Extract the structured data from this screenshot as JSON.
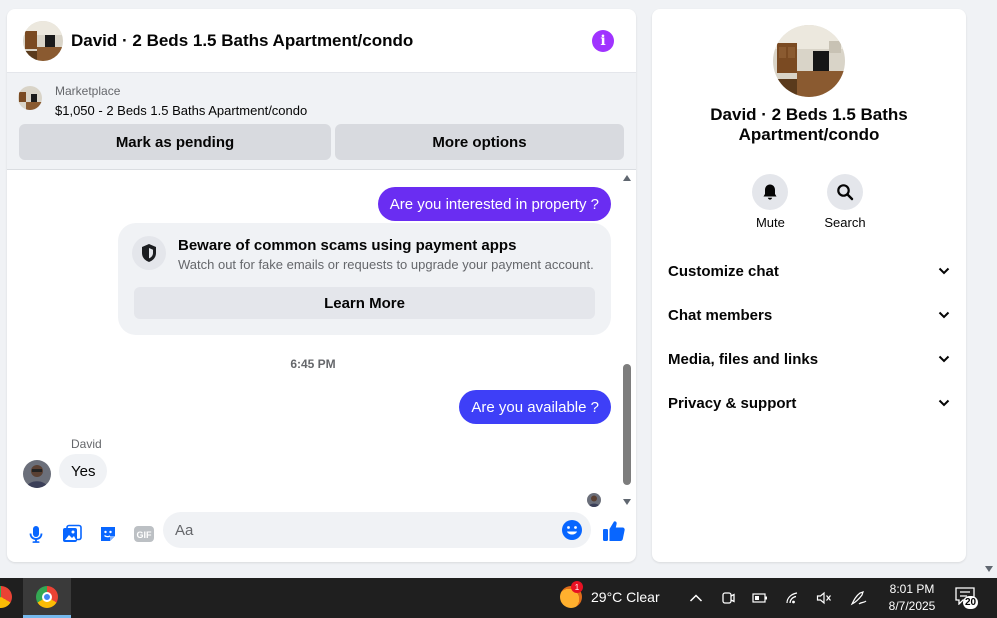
{
  "chat": {
    "title": "David · 2 Beds 1.5 Baths Apartment/condo",
    "marketplace": {
      "label": "Marketplace",
      "listing": "$1,050 - 2 Beds 1.5 Baths Apartment/condo",
      "mark_pending": "Mark as pending",
      "more_options": "More options"
    },
    "messages": {
      "out_1": "Are you interested in property ?",
      "scam_title": "Beware of common scams using payment apps",
      "scam_subtitle": "Watch out for fake emails or requests to upgrade your payment account.",
      "learn_more": "Learn More",
      "timestamp": "6:45 PM",
      "out_2": "Are you available ?",
      "sender": "David",
      "in_1": "Yes"
    },
    "composer": {
      "placeholder": "Aa"
    }
  },
  "info": {
    "title": "David · 2 Beds 1.5 Baths Apartment/condo",
    "actions": {
      "mute": "Mute",
      "search": "Search"
    },
    "sections": [
      "Customize chat",
      "Chat members",
      "Media, files and links",
      "Privacy & support"
    ]
  },
  "taskbar": {
    "weather_badge": "1",
    "weather": "29°C  Clear",
    "time": "8:01 PM",
    "date": "8/7/2025",
    "notifications": "20"
  },
  "colors": {
    "accent": "#3e3ff7",
    "accent_purple": "#6a2df2",
    "info_icon": "#a033ff"
  }
}
